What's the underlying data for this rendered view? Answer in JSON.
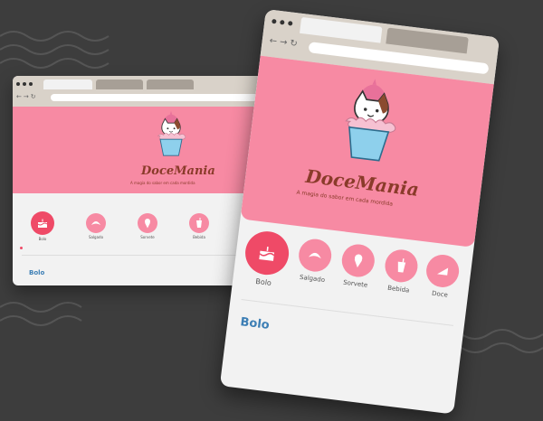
{
  "brand": {
    "name": "DoceMania",
    "tagline": "A magia do sabor em cada mordida"
  },
  "categories": [
    {
      "label": "Bolo",
      "icon": "cake-icon",
      "active": true
    },
    {
      "label": "Salgado",
      "icon": "croissant-icon",
      "active": false
    },
    {
      "label": "Sorvete",
      "icon": "ice-cream-icon",
      "active": false
    },
    {
      "label": "Bebida",
      "icon": "drink-icon",
      "active": false
    },
    {
      "label": "Doce",
      "icon": "pie-icon",
      "active": false
    }
  ],
  "section": {
    "title": "Bolo"
  },
  "nav": {
    "back": "←",
    "forward": "→",
    "reload": "↻"
  },
  "colors": {
    "background": "#3d3d3d",
    "hero": "#f78aa3",
    "accent": "#ef4a67",
    "brand_text": "#8a3b2a",
    "section_title": "#3d7fb5",
    "chrome": "#d9d2c9"
  }
}
